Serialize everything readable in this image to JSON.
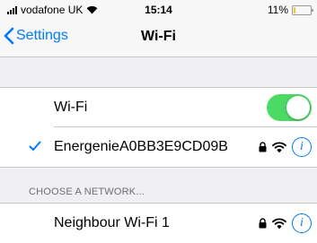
{
  "status_bar": {
    "carrier": "vodafone UK",
    "time": "15:14",
    "battery_text": "11%",
    "battery_level": 0.11,
    "battery_color": "#f2c418"
  },
  "nav": {
    "back_label": "Settings",
    "title": "Wi-Fi"
  },
  "wifi": {
    "label": "Wi-Fi",
    "enabled": true,
    "toggle_color": "#4cd964"
  },
  "connected_network": {
    "name": "EnergenieA0BB3E9CD09B",
    "secured": true,
    "icons": [
      "checkmark-icon",
      "lock-icon",
      "wifi-signal-icon",
      "info-icon"
    ]
  },
  "networks_section": {
    "header": "CHOOSE A NETWORK...",
    "items": [
      {
        "name": "Neighbour Wi-Fi 1",
        "secured": true
      }
    ]
  },
  "colors": {
    "accent": "#007aff",
    "background": "#efeff4"
  }
}
